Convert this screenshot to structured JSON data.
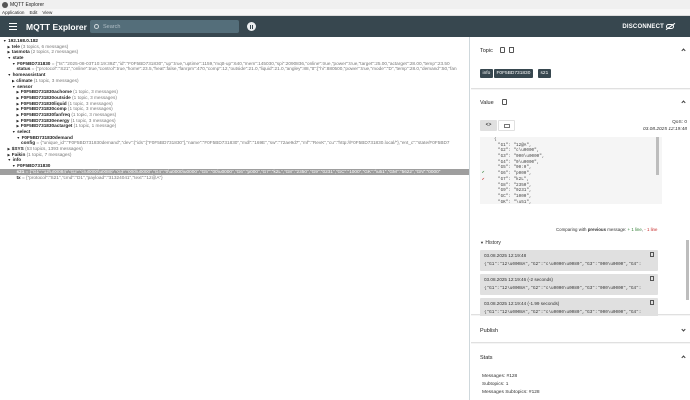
{
  "window": {
    "title": "MQTT Explorer"
  },
  "menu": [
    "Application",
    "Edit",
    "View"
  ],
  "appbar": {
    "brand": "MQTT Explorer",
    "search_placeholder": "Search",
    "disconnect": "DISCONNECT"
  },
  "tree": [
    {
      "indent": 0,
      "arrow": "▼",
      "key": "192.168.0.182",
      "meta": ""
    },
    {
      "indent": 1,
      "arrow": "▶",
      "key": "tele",
      "meta": " (3 topics, 6 messages)"
    },
    {
      "indent": 1,
      "arrow": "▶",
      "key": "tasmota",
      "meta": " (2 topics, 2 messages)"
    },
    {
      "indent": 1,
      "arrow": "▼",
      "key": "state",
      "meta": ""
    },
    {
      "indent": 2,
      "arrow": "▼",
      "key": "F0F5BD731830",
      "meta": " = {\"ts\":\"2025-08-03T10:19:39Z\",\"id\":\"F0F5BD731830\",\"up\":true,\"uptime\":1159,\"mqtt-up\":640,\"mem\":145030,\"spi\":2090836,\"online\":true,\"power\":true,\"target\":25.00,\"actarget\":28.00,\"temp\":23.50"
    },
    {
      "indent": 3,
      "arrow": "",
      "key": "status",
      "meta": " = {\"protocol\":\"S21\",\"online\":true,\"control\":true,\"home\":23.5,\"heat\":false,\"fanrpm\":470,\"comp\":12,\"outside\":21.0,\"liquid\":21.0,\"angley\":88,\"tt\":[\"hi\":880500,\"power\":true,\"mode\":\"D\",\"temp\":28.0,\"demand\":50,\"fan"
    },
    {
      "indent": 1,
      "arrow": "▼",
      "key": "homeassistant",
      "meta": ""
    },
    {
      "indent": 2,
      "arrow": "▶",
      "key": "climate",
      "meta": " (1 topic, 3 messages)"
    },
    {
      "indent": 2,
      "arrow": "▼",
      "key": "sensor",
      "meta": ""
    },
    {
      "indent": 3,
      "arrow": "▶",
      "key": "F0F5BD731830achome",
      "meta": " (1 topic, 3 messages)"
    },
    {
      "indent": 3,
      "arrow": "▶",
      "key": "F0F5BD731830outside",
      "meta": " (1 topic, 3 messages)"
    },
    {
      "indent": 3,
      "arrow": "▶",
      "key": "F0F5BD731830liquid",
      "meta": " (1 topic, 3 messages)"
    },
    {
      "indent": 3,
      "arrow": "▶",
      "key": "F0F5BD731830comp",
      "meta": " (1 topic, 3 messages)"
    },
    {
      "indent": 3,
      "arrow": "▶",
      "key": "F0F5BD731830fanfreq",
      "meta": " (1 topic, 3 messages)"
    },
    {
      "indent": 3,
      "arrow": "▶",
      "key": "F0F5BD731830energy",
      "meta": " (1 topic, 3 messages)"
    },
    {
      "indent": 3,
      "arrow": "▶",
      "key": "F0F5BD731830actarget",
      "meta": " (1 topic, 1 message)"
    },
    {
      "indent": 2,
      "arrow": "▼",
      "key": "select",
      "meta": ""
    },
    {
      "indent": 3,
      "arrow": "▼",
      "key": "F0F5BD731830demand",
      "meta": ""
    },
    {
      "indent": 4,
      "arrow": "",
      "key": "config",
      "meta": " = {\"unique_id\":\"F0F5BD731830demand\",\"dev\":{\"ids\":[\"F0F5BD731830\"],\"name\":\"F0F5BD731830\",\"mdl\":\"169E\",\"sw\":\"72ae9d7\",\"mf\":\"RevK\",\"cu\":\"http://F0F5BD731830.local/\"},\"ent_c\":\"state/F0F5BD7"
    },
    {
      "indent": 1,
      "arrow": "▶",
      "key": "$SYS",
      "meta": " (53 topics, 1393 messages)"
    },
    {
      "indent": 1,
      "arrow": "▶",
      "key": "Faikin",
      "meta": " (1 topic, 7 messages)"
    },
    {
      "indent": 1,
      "arrow": "▼",
      "key": "info",
      "meta": ""
    },
    {
      "indent": 2,
      "arrow": "▼",
      "key": "F0F5BD731830",
      "meta": ""
    },
    {
      "indent": 3,
      "arrow": "",
      "key": "s21",
      "meta": " = {\"G1\":\"12\\u00084\",\"G2\":\"c\\u0000\\u0080\",\"G3\":\"000\\u0000\",\"G4\":\"0\\u0000\\u0000\",\"G5\":\"00\\u0000\",\"G6\":\"p000\",\"G7\":\"k2L\",\"G8\":\"2350\",\"G9\":\"0231\",\"GC\":\"1000\",\"GK\":\"\\u51\",\"GM\":\"5622\",\"GN\":\"0000\"",
      "selected": true
    },
    {
      "indent": 3,
      "arrow": "",
      "key": "tx",
      "meta": " = {\"protocol\":\"S21\",\"cmd\":\"D1\",\"payload\":\"31324041\",\"text\":\"12@A\"}"
    }
  ],
  "topic": {
    "title": "Topic",
    "chips": [
      "info",
      "F0F5BD731830",
      "s21"
    ]
  },
  "value": {
    "title": "Value",
    "qos": "QoS: 0",
    "timestamp": "03.08.2025 12:19:48",
    "code_lines": [
      "{",
      "\"G1\": \"12@A\",",
      "\"G2\": \"c\\u0000\",",
      "\"G3\": \"000\\u0000\",",
      "\"G4\": \"0\\u0000\",",
      "\"G5\": \"00:0\",",
      "\"G6\": \"p000\",",
      "\"G7\": \"k2L\",",
      "\"G8\": \"2350\",",
      "\"G9\": \"0231\",",
      "\"GC\": \"1000\",",
      "\"GK\": \"\\u51\","
    ],
    "compare_prefix": "Comparing with ",
    "compare_bold": "previous",
    "compare_suffix": " message: ",
    "added": "+ 1 line",
    "removed": "- 1 line"
  },
  "history": {
    "title": "History",
    "items": [
      {
        "time": "03.08.2025 12:19:48",
        "payload": "{\"G1\":\"12\\u0008A\",\"G2\":\"c\\u0000\\u0080\",\"G3\":\"000\\u0000\",\"G4\":"
      },
      {
        "time": "03.08.2025 12:19:46 (-2 seconds)",
        "payload": "{\"G1\":\"12\\u0008A\",\"G2\":\"c\\u0000\\u0080\",\"G3\":\"000\\u0000\",\"G4\":"
      },
      {
        "time": "03.08.2025 12:19:44 (-1.99 seconds)",
        "payload": "{\"G1\":\"12\\u0008A\",\"G2\":\"c\\u0000\\u0080\",\"G3\":\"000\\u0000\",\"G4\":"
      }
    ]
  },
  "publish": {
    "title": "Publish"
  },
  "stats": {
    "title": "Stats",
    "lines": [
      "Messages: #128",
      "Subtopics: 1",
      "Messages Subtopics: #128"
    ]
  }
}
